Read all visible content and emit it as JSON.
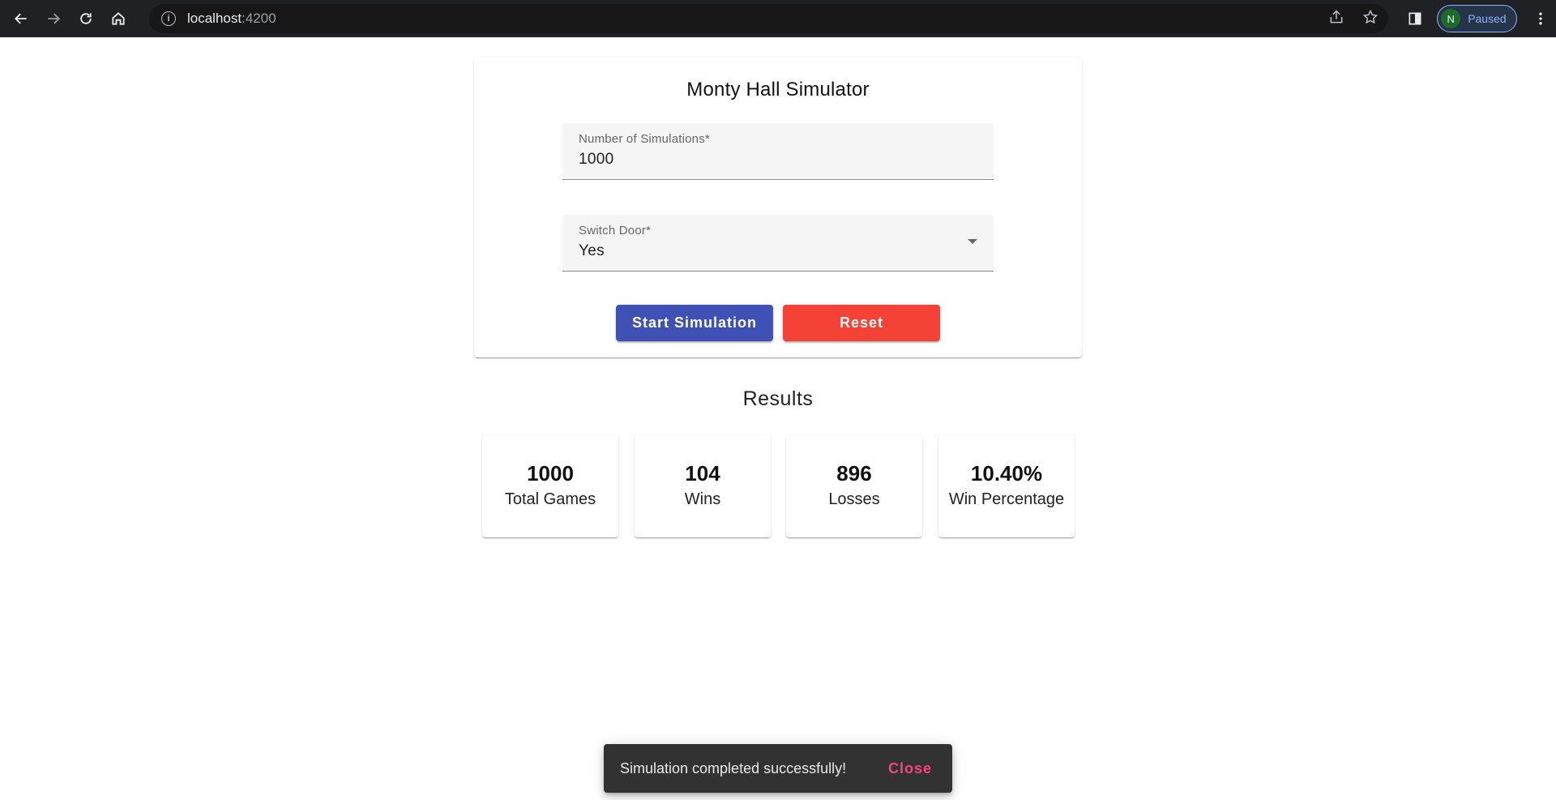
{
  "browser": {
    "url_host": "localhost",
    "url_port": ":4200",
    "profile_initial": "N",
    "profile_status": "Paused"
  },
  "form": {
    "title": "Monty Hall Simulator",
    "simulations_label": "Number of Simulations*",
    "simulations_value": "1000",
    "switch_label": "Switch Door*",
    "switch_value": "Yes",
    "start_label": "Start Simulation",
    "reset_label": "Reset"
  },
  "results": {
    "heading": "Results",
    "stats": [
      {
        "value": "1000",
        "label": "Total Games"
      },
      {
        "value": "104",
        "label": "Wins"
      },
      {
        "value": "896",
        "label": "Losses"
      },
      {
        "value": "10.40%",
        "label": "Win Percentage"
      }
    ]
  },
  "snackbar": {
    "message": "Simulation completed successfully!",
    "action": "Close"
  },
  "colors": {
    "primary": "#3f51b5",
    "warn": "#f44336",
    "snackbar_action": "#ff4081"
  }
}
